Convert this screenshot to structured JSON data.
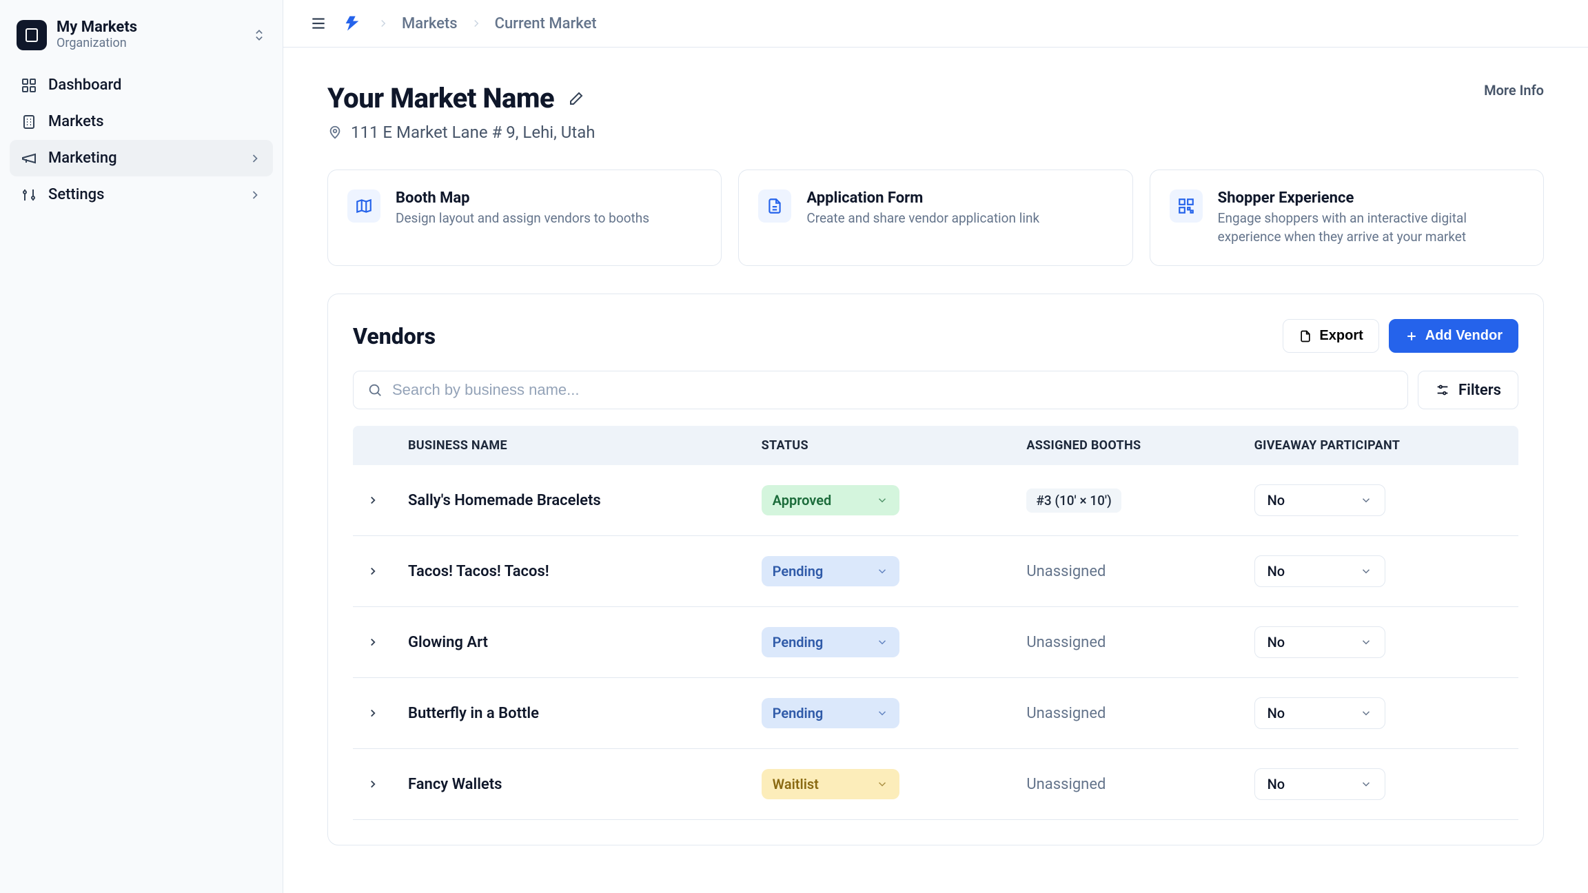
{
  "org": {
    "name": "My Markets",
    "subtitle": "Organization"
  },
  "nav": {
    "dashboard": "Dashboard",
    "markets": "Markets",
    "marketing": "Marketing",
    "settings": "Settings"
  },
  "breadcrumb": {
    "markets": "Markets",
    "current": "Current Market"
  },
  "header": {
    "title": "Your Market Name",
    "address": "111 E Market Lane # 9, Lehi, Utah",
    "more_info": "More Info"
  },
  "cards": {
    "booth_map": {
      "title": "Booth Map",
      "desc": "Design layout and assign vendors to booths"
    },
    "application": {
      "title": "Application Form",
      "desc": "Create and share vendor application link"
    },
    "shopper": {
      "title": "Shopper Experience",
      "desc": "Engage shoppers with an interactive digital experience when they arrive at your market"
    }
  },
  "vendors": {
    "title": "Vendors",
    "export": "Export",
    "add": "Add Vendor",
    "search_placeholder": "Search by business name...",
    "filters": "Filters",
    "columns": {
      "name": "BUSINESS NAME",
      "status": "STATUS",
      "booths": "ASSIGNED BOOTHS",
      "giveaway": "GIVEAWAY PARTICIPANT"
    },
    "status_labels": {
      "Approved": "Approved",
      "Pending": "Pending",
      "Waitlist": "Waitlist"
    },
    "rows": [
      {
        "name": "Sally's Homemade Bracelets",
        "status": "Approved",
        "booth": "#3 (10' × 10')",
        "giveaway": "No"
      },
      {
        "name": "Tacos! Tacos! Tacos!",
        "status": "Pending",
        "booth": "Unassigned",
        "giveaway": "No"
      },
      {
        "name": "Glowing Art",
        "status": "Pending",
        "booth": "Unassigned",
        "giveaway": "No"
      },
      {
        "name": "Butterfly in a Bottle",
        "status": "Pending",
        "booth": "Unassigned",
        "giveaway": "No"
      },
      {
        "name": "Fancy Wallets",
        "status": "Waitlist",
        "booth": "Unassigned",
        "giveaway": "No"
      }
    ]
  }
}
